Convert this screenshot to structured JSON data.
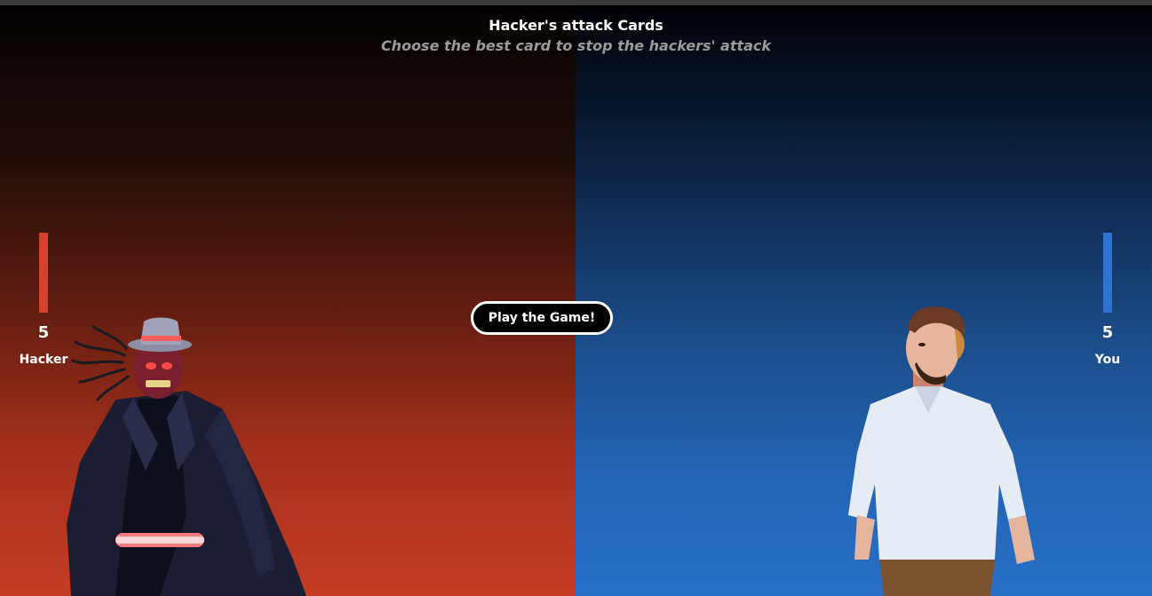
{
  "header": {
    "title": "Hacker's attack Cards",
    "subtitle": "Choose the best card to stop the hackers' attack"
  },
  "hacker": {
    "score": "5",
    "label": "Hacker",
    "bar_color": "#d5412a",
    "icon": "hacker-character"
  },
  "player": {
    "score": "5",
    "label": "You",
    "bar_color": "#2f72cf",
    "icon": "player-character"
  },
  "play_button": {
    "label": "Play the Game!"
  },
  "colors": {
    "hacker_side": "#c63c24",
    "player_side": "#2870c8"
  }
}
